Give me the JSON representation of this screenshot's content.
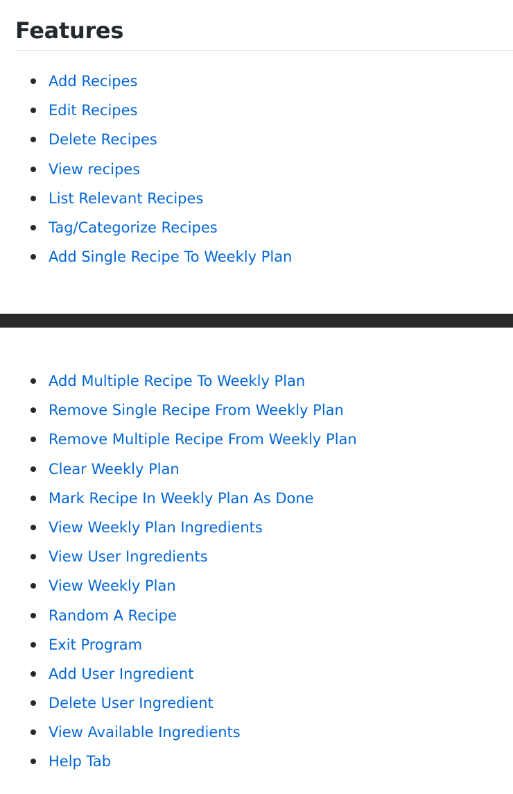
{
  "section": {
    "title": "Features"
  },
  "features_top": [
    "Add Recipes",
    "Edit Recipes",
    "Delete Recipes",
    "View recipes",
    "List Relevant Recipes",
    "Tag/Categorize Recipes",
    "Add Single Recipe To Weekly Plan"
  ],
  "features_bottom": [
    "Add Multiple Recipe To Weekly Plan",
    "Remove Single Recipe From Weekly Plan",
    "Remove Multiple Recipe From Weekly Plan",
    "Clear Weekly Plan",
    "Mark Recipe In Weekly Plan As Done",
    "View Weekly Plan Ingredients",
    "View User Ingredients",
    "View Weekly Plan",
    "Random A Recipe",
    "Exit Program",
    "Add User Ingredient",
    "Delete User Ingredient",
    "View Available Ingredients",
    "Help Tab"
  ],
  "colors": {
    "link": "#0366d6",
    "text": "#24292e",
    "rule": "#e1e4e8",
    "bar": "#2a2a2a"
  }
}
